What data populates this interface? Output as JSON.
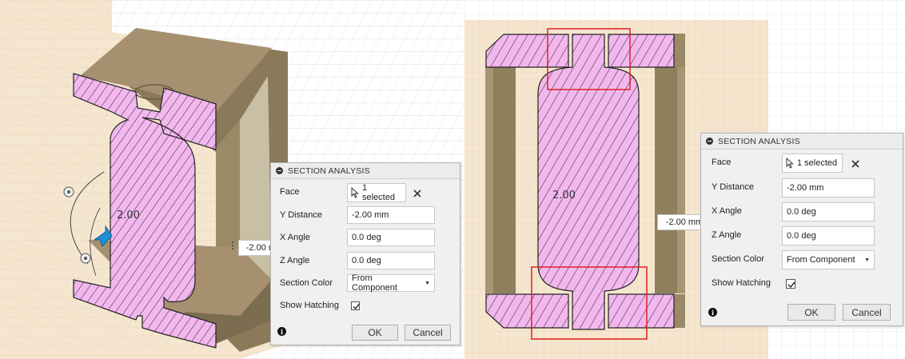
{
  "left_view": {
    "dimension_label": "2.00",
    "distance_field_value": "-2.00 mm",
    "panel": {
      "title": "SECTION ANALYSIS",
      "face_label": "Face",
      "face_selection": "1 selected",
      "y_distance_label": "Y Distance",
      "y_distance_value": "-2.00 mm",
      "x_angle_label": "X Angle",
      "x_angle_value": "0.0 deg",
      "z_angle_label": "Z Angle",
      "z_angle_value": "0.0 deg",
      "section_color_label": "Section Color",
      "section_color_value": "From Component",
      "show_hatching_label": "Show Hatching",
      "show_hatching_checked": true,
      "ok_label": "OK",
      "cancel_label": "Cancel"
    }
  },
  "right_view": {
    "dimension_label": "2.00",
    "distance_field_value": "-2.00 mm",
    "panel": {
      "title": "SECTION ANALYSIS",
      "face_label": "Face",
      "face_selection": "1 selected",
      "y_distance_label": "Y Distance",
      "y_distance_value": "-2.00 mm",
      "x_angle_label": "X Angle",
      "x_angle_value": "0.0 deg",
      "z_angle_label": "Z Angle",
      "z_angle_value": "0.0 deg",
      "section_color_label": "Section Color",
      "section_color_value": "From Component",
      "show_hatching_label": "Show Hatching",
      "show_hatching_checked": true,
      "ok_label": "OK",
      "cancel_label": "Cancel"
    }
  },
  "colors": {
    "section_fill": "#f2b8ee",
    "hatch": "#2a1a2a",
    "body": "#8a7a5a",
    "ground": "#f5e6cf",
    "grid_light": "#e6e6e6",
    "highlight_box": "#e02020",
    "gizmo_arrow": "#1e8fd6"
  }
}
